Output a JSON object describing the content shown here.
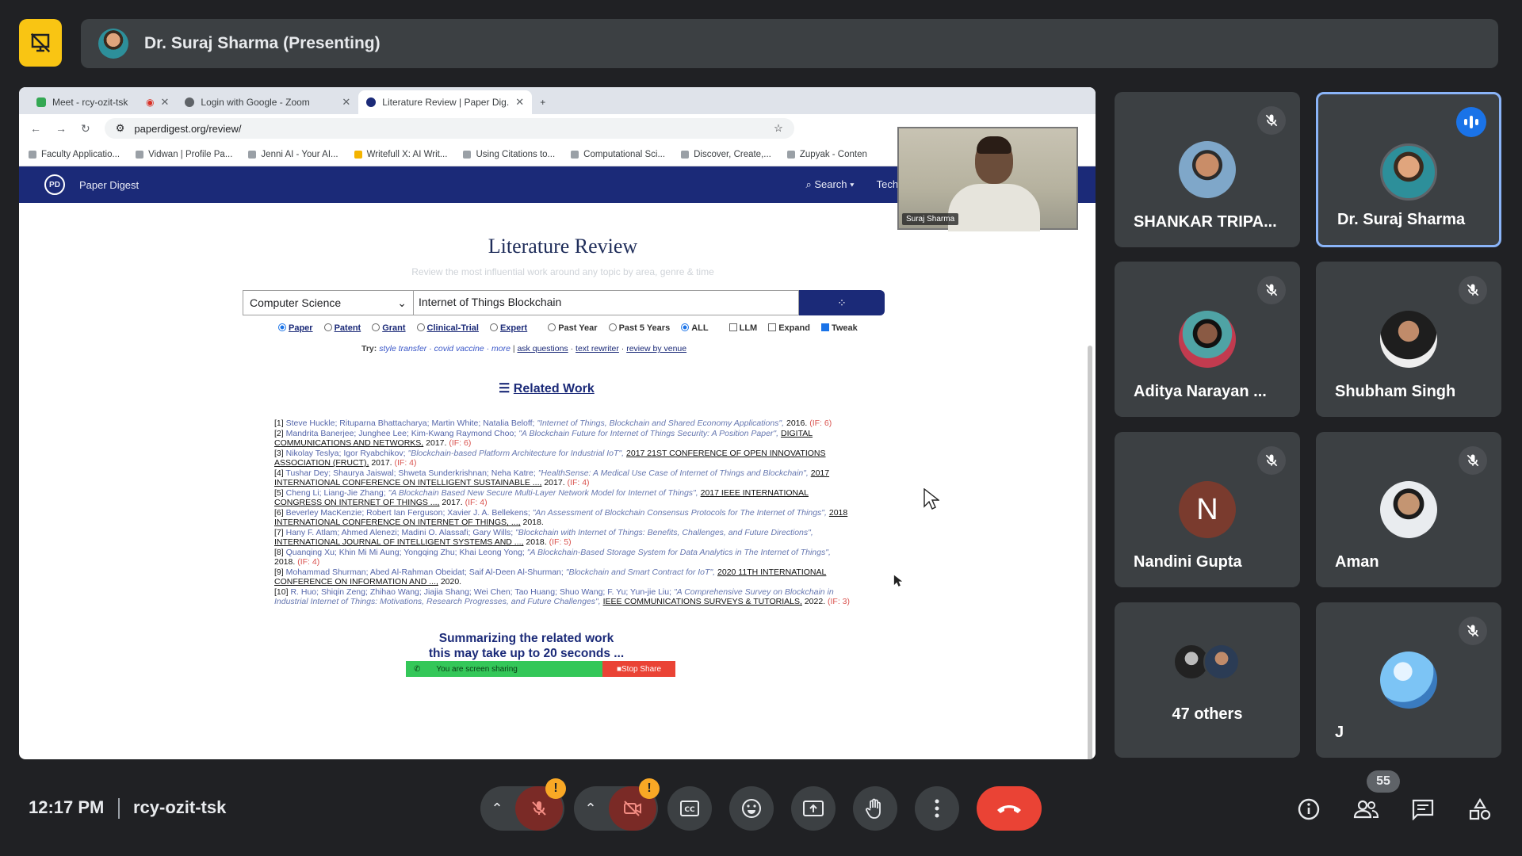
{
  "meeting": {
    "presenter_label": "Dr. Suraj Sharma (Presenting)",
    "time": "12:17 PM",
    "code": "rcy-ozit-tsk",
    "participant_count": "55"
  },
  "browser": {
    "tabs": [
      {
        "label": "Meet - rcy-ozit-tsk"
      },
      {
        "label": "Login with Google - Zoom"
      },
      {
        "label": "Literature Review | Paper Dig..."
      }
    ],
    "url": "paperdigest.org/review/",
    "bookmarks": [
      "Faculty Applicatio...",
      "Vidwan | Profile Pa...",
      "Jenni AI - Your AI...",
      "Writefull X: AI Writ...",
      "Using Citations to...",
      "Computational Sci...",
      "Discover, Create,...",
      "Zupyak - Conten"
    ]
  },
  "site": {
    "brand": "Paper Digest",
    "nav_search": "Search",
    "nav_tech": "Tech NLP",
    "title": "Literature Review",
    "subtitle": "Review the most influential work around any topic by area, genre & time",
    "category": "Computer Science",
    "query": "Internet of Things Blockchain",
    "options": {
      "paper": "Paper",
      "patent": "Patent",
      "grant": "Grant",
      "clinical": "Clinical-Trial",
      "expert": "Expert",
      "past_year": "Past Year",
      "past5": "Past 5 Years",
      "all": "ALL",
      "llm": "LLM",
      "expand": "Expand",
      "tweak": "Tweak"
    },
    "try_prefix": "Try:",
    "try_examples": "style transfer · covid vaccine · more",
    "try_ask": "ask questions",
    "try_rewrite": "text rewriter",
    "try_venue": "review by venue",
    "related_work": "Related Work",
    "references": [
      {
        "n": "[1]",
        "authors": "Steve Huckle; Rituparna Bhattacharya; Martin White; Natalia Beloff;",
        "title": "\"Internet of Things, Blockchain and Shared Economy Applications\",",
        "venue": "",
        "year": "2016.",
        "if": "(IF: 6)"
      },
      {
        "n": "[2]",
        "authors": "Mandrita Banerjee; Junghee Lee; Kim-Kwang Raymond Choo;",
        "title": "\"A Blockchain Future for Internet of Things Security: A Position Paper\",",
        "venue": "DIGITAL COMMUNICATIONS AND NETWORKS,",
        "year": "2017.",
        "if": "(IF: 6)"
      },
      {
        "n": "[3]",
        "authors": "Nikolay Teslya; Igor Ryabchikov;",
        "title": "\"Blockchain-based Platform Architecture for Industrial IoT\",",
        "venue": "2017 21ST CONFERENCE OF OPEN INNOVATIONS ASSOCIATION (FRUCT),",
        "year": "2017.",
        "if": "(IF: 4)"
      },
      {
        "n": "[4]",
        "authors": "Tushar Dey; Shaurya Jaiswal; Shweta Sunderkrishnan; Neha Katre;",
        "title": "\"HealthSense: A Medical Use Case of Internet of Things and Blockchain\",",
        "venue": "2017 INTERNATIONAL CONFERENCE ON INTELLIGENT SUSTAINABLE ...,",
        "year": "2017.",
        "if": "(IF: 4)"
      },
      {
        "n": "[5]",
        "authors": "Cheng Li; Liang-Jie Zhang;",
        "title": "\"A Blockchain Based New Secure Multi-Layer Network Model for Internet of Things\",",
        "venue": "2017 IEEE INTERNATIONAL CONGRESS ON INTERNET OF THINGS ...,",
        "year": "2017.",
        "if": "(IF: 4)"
      },
      {
        "n": "[6]",
        "authors": "Beverley MacKenzie; Robert Ian Ferguson; Xavier J. A. Bellekens;",
        "title": "\"An Assessment of Blockchain Consensus Protocols for The Internet of Things\",",
        "venue": "2018 INTERNATIONAL CONFERENCE ON INTERNET OF THINGS, ...,",
        "year": "2018.",
        "if": ""
      },
      {
        "n": "[7]",
        "authors": "Hany F. Atlam; Ahmed Alenezi; Madini O. Alassafi; Gary Wills;",
        "title": "\"Blockchain with Internet of Things: Benefits, Challenges, and Future Directions\",",
        "venue": "INTERNATIONAL JOURNAL OF INTELLIGENT SYSTEMS AND ...,",
        "year": "2018.",
        "if": "(IF: 5)"
      },
      {
        "n": "[8]",
        "authors": "Quanqing Xu; Khin Mi Mi Aung; Yongqing Zhu; Khai Leong Yong;",
        "title": "\"A Blockchain-Based Storage System for Data Analytics in The Internet of Things\",",
        "venue": "",
        "year": "2018.",
        "if": "(IF: 4)"
      },
      {
        "n": "[9]",
        "authors": "Mohammad Shurman; Abed Al-Rahman Obeidat; Saif Al-Deen Al-Shurman;",
        "title": "\"Blockchain and Smart Contract for IoT\",",
        "venue": "2020 11TH INTERNATIONAL CONFERENCE ON INFORMATION AND ...,",
        "year": "2020.",
        "if": ""
      },
      {
        "n": "[10]",
        "authors": "R. Huo; Shiqin Zeng; Zhihao Wang; Jiajia Shang; Wei Chen; Tao Huang; Shuo Wang; F. Yu; Yun-jie Liu;",
        "title": "\"A Comprehensive Survey on Blockchain in Industrial Internet of Things: Motivations, Research Progresses, and Future Challenges\",",
        "venue": "IEEE COMMUNICATIONS SURVEYS & TUTORIALS,",
        "year": "2022.",
        "if": "(IF: 3)"
      }
    ],
    "summarizing_1": "Summarizing the related work",
    "summarizing_2": "this may take up to 20 seconds ...",
    "share_banner_text": "You are screen sharing",
    "stop_share": "Stop Share"
  },
  "pip_label": "Suraj Sharma",
  "participants": [
    {
      "name": "SHANKAR TRIPA...",
      "muted": true
    },
    {
      "name": "Dr. Suraj Sharma",
      "speaking": true
    },
    {
      "name": "Aditya Narayan ...",
      "muted": true
    },
    {
      "name": "Shubham Singh",
      "muted": true
    },
    {
      "name": "Nandini Gupta",
      "initial": "N",
      "muted": true
    },
    {
      "name": "Aman",
      "muted": true
    },
    {
      "name": "47 others"
    },
    {
      "name": "J",
      "muted": true
    }
  ],
  "colors": {
    "accent": "#8ab4f8",
    "leave": "#ea4335",
    "warning": "#f9a825",
    "site_nav": "#1b2a78"
  }
}
